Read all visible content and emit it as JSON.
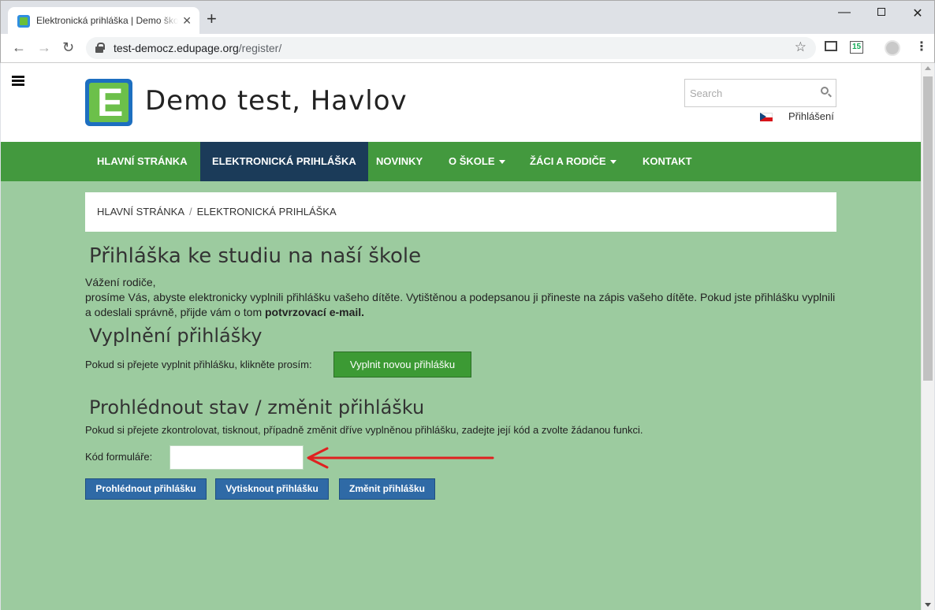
{
  "browser": {
    "tab_title": "Elektronická prihláška | Demo škola",
    "tab_close": "✕",
    "new_tab": "+",
    "url_host": "test-democz.edupage.org",
    "url_path": "/register/",
    "star": "☆",
    "ext_cal": "15",
    "window_min": "—",
    "window_close": "✕",
    "menu": "⋮",
    "back": "←",
    "forward": "→",
    "reload": "↻"
  },
  "site": {
    "title": "Demo test, Havlov",
    "logo_letter": "E",
    "search_placeholder": "Search",
    "login": "Přihlášení"
  },
  "nav": {
    "items": [
      {
        "label": "HLAVNÍ STRÁNKA"
      },
      {
        "label": "ELEKTRONICKÁ PRIHLÁŠKA"
      },
      {
        "label": "NOVINKY"
      },
      {
        "label": "O ŠKOLE"
      },
      {
        "label": "ŽÁCI A RODIČE"
      },
      {
        "label": "KONTAKT"
      }
    ]
  },
  "breadcrumb": {
    "home": "HLAVNÍ STRÁNKA",
    "separator": "/",
    "current": "ELEKTRONICKÁ PRIHLÁŠKA"
  },
  "main": {
    "heading": "Přihláška ke studiu na naší škole",
    "greeting": "Vážení rodiče,",
    "intro_text": "prosíme Vás, abyste elektronicky vyplnili přihlášku vašeho dítěte. Vytištěnou a podepsanou ji přineste na zápis vašeho dítěte. Pokud jste přihlášku vyplnili a odeslali správně, přijde vám o tom ",
    "intro_bold": "potvrzovací e-mail.",
    "fill_heading": "Vyplnění přihlášky",
    "fill_text": "Pokud si přejete vyplnit přihlášku, klikněte prosím:",
    "fill_button": "Vyplnit novou přihlášku",
    "view_heading": "Prohlédnout stav / změnit přihlášku",
    "view_text": "Pokud si přejete zkontrolovat, tisknout, případně změnit dříve vyplněnou přihlášku, zadejte její kód a zvolte žádanou funkci.",
    "code_label": "Kód formuláře:",
    "code_value": "",
    "btn_view": "Prohlédnout přihlášku",
    "btn_print": "Vytisknout přihlášku",
    "btn_change": "Změnit přihlášku"
  },
  "colors": {
    "nav_green": "#43993e",
    "nav_active": "#1b3b59",
    "page_bg": "#9ccb9f",
    "button_green": "#3c9a34",
    "button_blue": "#2f6aa6",
    "arrow_red": "#e02020"
  }
}
